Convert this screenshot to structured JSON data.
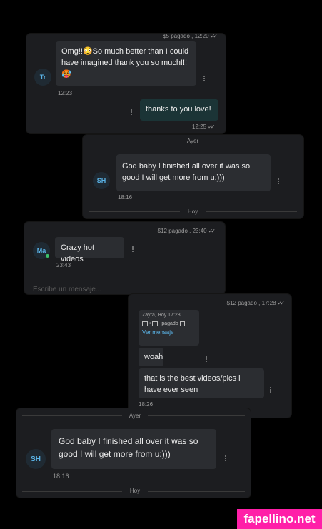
{
  "card1": {
    "paid_meta": "$5 pagado , 12:20",
    "avatar": "Tr",
    "message": "Omg!!😳So much better than I could have imagined thank you so much!!!🥵",
    "message_time": "12:23",
    "reply": "thanks to you love!",
    "reply_time": "12:25"
  },
  "card2": {
    "day_top": "Ayer",
    "avatar": "SH",
    "message": "God baby I finished all over it was so good I will get more from u:)))",
    "message_time": "18:16",
    "day_bottom": "Hoy"
  },
  "card3": {
    "paid_meta": "$12 pagado , 23:40",
    "avatar": "Ma",
    "message": "Crazy hot videos",
    "message_time": "23:43",
    "input_placeholder": "Escribe un mensaje..."
  },
  "card4": {
    "paid_meta": "$12 pagado , 17:28",
    "quote_header": "Zayra, Hoy 17:28",
    "quote_paid": "pagado",
    "quote_link": "Ver mensaje",
    "msg1": "woah",
    "msg2": "that is the best videos/pics i have ever seen",
    "time": "18:26"
  },
  "card5": {
    "day_top": "Ayer",
    "avatar": "SH",
    "message": "God baby I finished all over it was so good I will get more from u:)))",
    "message_time": "18:16",
    "day_bottom": "Hoy"
  },
  "watermark": "fapellino.net",
  "colors": {
    "accent": "#5ab3e6",
    "online": "#3cc26a",
    "watermark": "#ff1fa8"
  }
}
